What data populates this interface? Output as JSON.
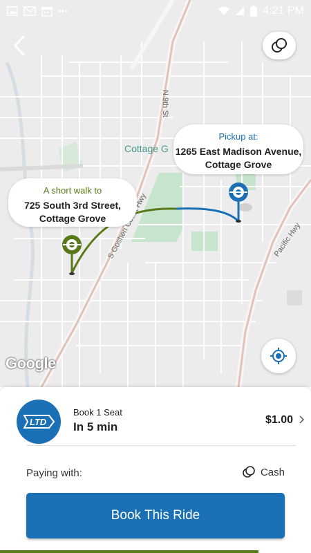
{
  "status_bar": {
    "time": "4:21 PM",
    "left_icons": [
      "image-icon",
      "gmail-icon",
      "calendar-icon",
      "more-icon"
    ],
    "right_icons": [
      "wifi-icon",
      "signal-icon",
      "battery-icon"
    ]
  },
  "map": {
    "labels": {
      "n_9th_st": "N 9th St",
      "cottage_grove": "Cottage G",
      "s_goshen": "S Goshen Coast Hwy",
      "pacific_hwy": "Pacific Hwy"
    },
    "google_logo": "Google",
    "walk_callout": {
      "label": "A short walk to",
      "address": "725 South 3rd Street, Cottage Grove"
    },
    "pickup_callout": {
      "label": "Pickup at:",
      "address": "1265 East Madison Avenue, Cottage Grove"
    },
    "colors": {
      "walk": "#5a7a1a",
      "ride": "#1b6fb5"
    }
  },
  "sheet": {
    "provider_logo_text": "LTD",
    "book_seat": "Book 1 Seat",
    "eta": "In 5 min",
    "price": "$1.00",
    "paying_with_label": "Paying with:",
    "payment_method": "Cash",
    "book_button": "Book This Ride",
    "progress": 0.83
  },
  "icons": {
    "back": "back-arrow-icon",
    "options": "ride-options-icon",
    "locate": "my-location-icon",
    "chevron": "chevron-right-icon",
    "cash": "cash-icon"
  }
}
